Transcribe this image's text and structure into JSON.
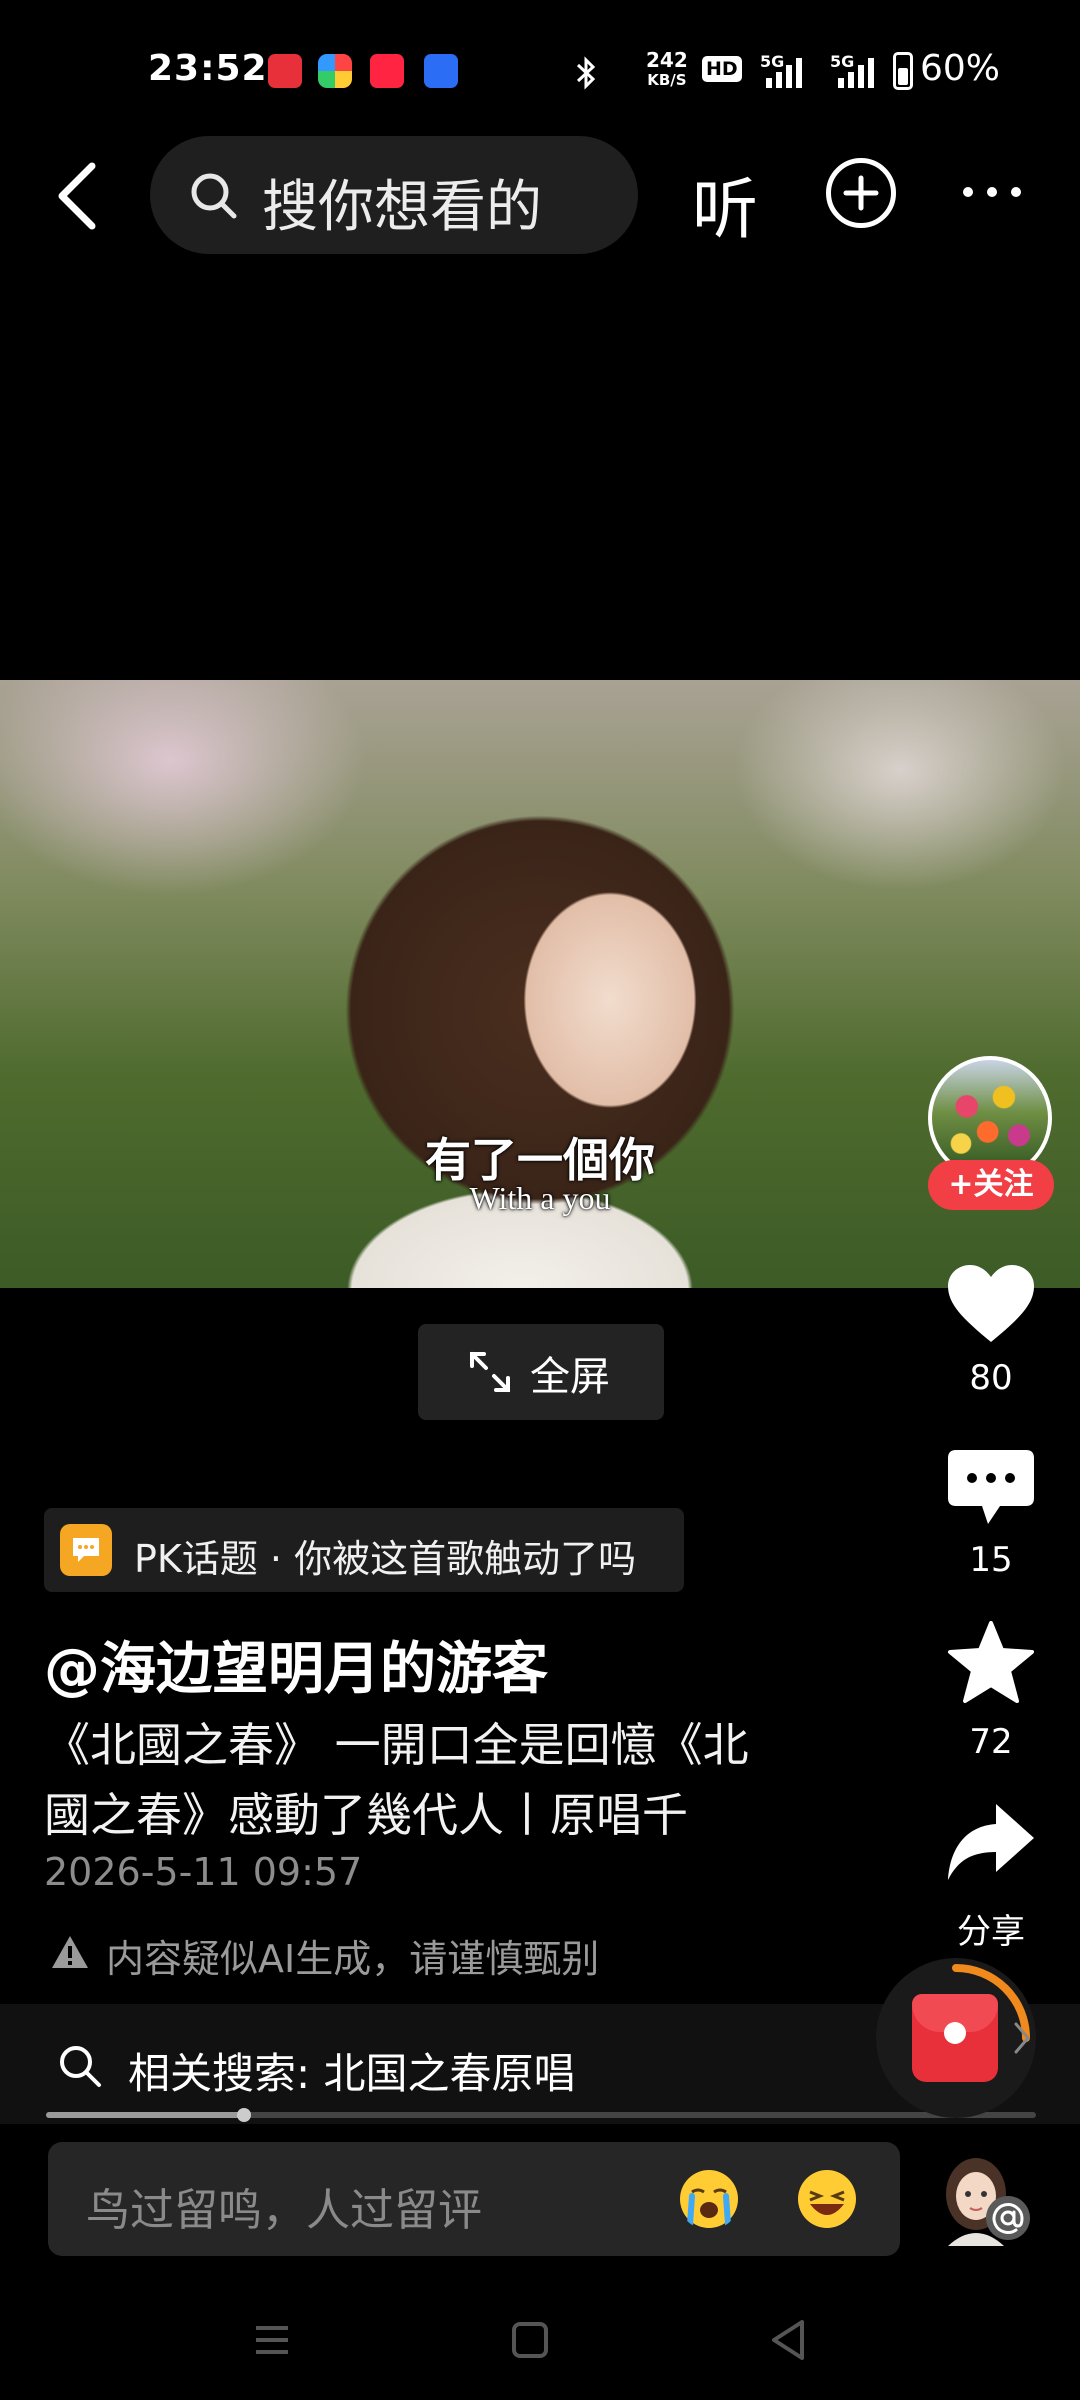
{
  "status_bar": {
    "time": "23:52",
    "net_speed_value": "242",
    "net_speed_unit": "KB/S",
    "hd_label": "HD",
    "network_1": "5G",
    "network_2": "5G",
    "battery_level": 0.6,
    "battery_percent": "60%",
    "notification_icons": [
      "toutiao-icon",
      "photos-icon",
      "xiaohongshu-icon",
      "baidu-icon"
    ]
  },
  "nav": {
    "search_placeholder": "搜你想看的",
    "listen_label": "听"
  },
  "video": {
    "subtitle_zh": "有了一個你",
    "subtitle_en": "With a you"
  },
  "fullscreen_label": "全屏",
  "rail": {
    "follow_label": "+关注",
    "like_count": "80",
    "comment_count": "15",
    "favorite_count": "72",
    "share_label": "分享"
  },
  "post": {
    "topic": "PK话题 · 你被这首歌触动了吗",
    "author": "@海边望明月的游客",
    "caption_line1": "《北國之春》 一開口全是回憶《北",
    "caption_line2": "國之春》感動了幾代人丨原唱千",
    "date": "2026-5-11 09:57",
    "ai_warning": "内容疑似AI生成，请谨慎甄别"
  },
  "related": {
    "label": "相关搜索: 北国之春原唱",
    "progress": 0.2
  },
  "comment": {
    "placeholder": "鸟过留鸣，人过留评",
    "emojis": [
      "crying-emoji",
      "laughing-emoji"
    ]
  },
  "colors": {
    "accent_red": "#f23f46",
    "topic_orange": "#f5a623"
  }
}
